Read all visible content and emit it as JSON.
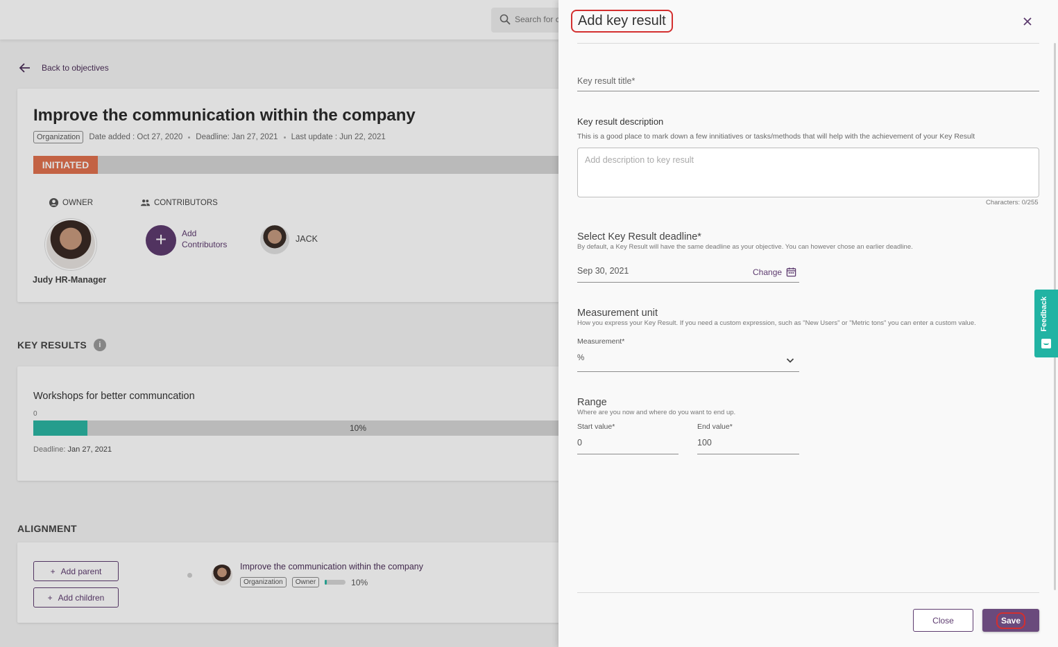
{
  "search": {
    "placeholder": "Search for c"
  },
  "back_link": {
    "label": "Back to objectives"
  },
  "objective": {
    "title": "Improve the communication within the company",
    "tag": "Organization",
    "date_added": "Date added : Oct 27, 2020",
    "deadline": "Deadline: Jan 27, 2021",
    "last_update": "Last update : Jun 22, 2021",
    "status": "INITIATED",
    "status_color": "#e0714f"
  },
  "people": {
    "owner_label": "OWNER",
    "owner_name": "Judy HR-Manager",
    "contributors_label": "CONTRIBUTORS",
    "add_contributors": [
      "Add",
      "Contributors"
    ],
    "contributor_name": "JACK"
  },
  "key_results": {
    "section_title": "KEY RESULTS",
    "info_glyph": "i",
    "item": {
      "title": "Workshops for better communcation",
      "min_value": "0",
      "progress": 10,
      "progress_label": "10%",
      "deadline_label": "Deadline:",
      "deadline_value": "Jan 27, 2021"
    }
  },
  "alignment": {
    "section_title": "ALIGNMENT",
    "add_parent": "Add parent",
    "add_children": "Add children",
    "item": {
      "title": "Improve the communication within the company",
      "tags": [
        "Organization",
        "Owner"
      ],
      "progress_label": "10%"
    }
  },
  "drawer": {
    "title": "Add key result",
    "title_field": {
      "placeholder": "Key result title*"
    },
    "description": {
      "label": "Key result description",
      "hint": "This is a good place to mark down a few innitiatives or tasks/methods that will help with the achievement of your Key Result",
      "placeholder": "Add description to key result",
      "char_count": "Characters: 0/255"
    },
    "deadline": {
      "label": "Select Key Result deadline*",
      "hint": "By default, a Key Result will have the same deadline as your objective. You can however chose an earlier deadline.",
      "value": "Sep 30, 2021",
      "change_label": "Change"
    },
    "measurement": {
      "label": "Measurement unit",
      "hint": "How you express your Key Result. If you need a custom expression, such as \"New Users\" or \"Metric tons\" you can enter a custom value.",
      "field_label": "Measurement*",
      "value": "%"
    },
    "range": {
      "label": "Range",
      "hint": "Where are you now and where do you want to end up.",
      "start_label": "Start value*",
      "start_value": "0",
      "end_label": "End value*",
      "end_value": "100"
    },
    "close_button": "Close",
    "save_button": "Save"
  },
  "feedback": {
    "label": "Feedback"
  },
  "colors": {
    "accent": "#5d3b6f",
    "teal": "#2bb5a3",
    "highlight": "#d32f2f"
  }
}
